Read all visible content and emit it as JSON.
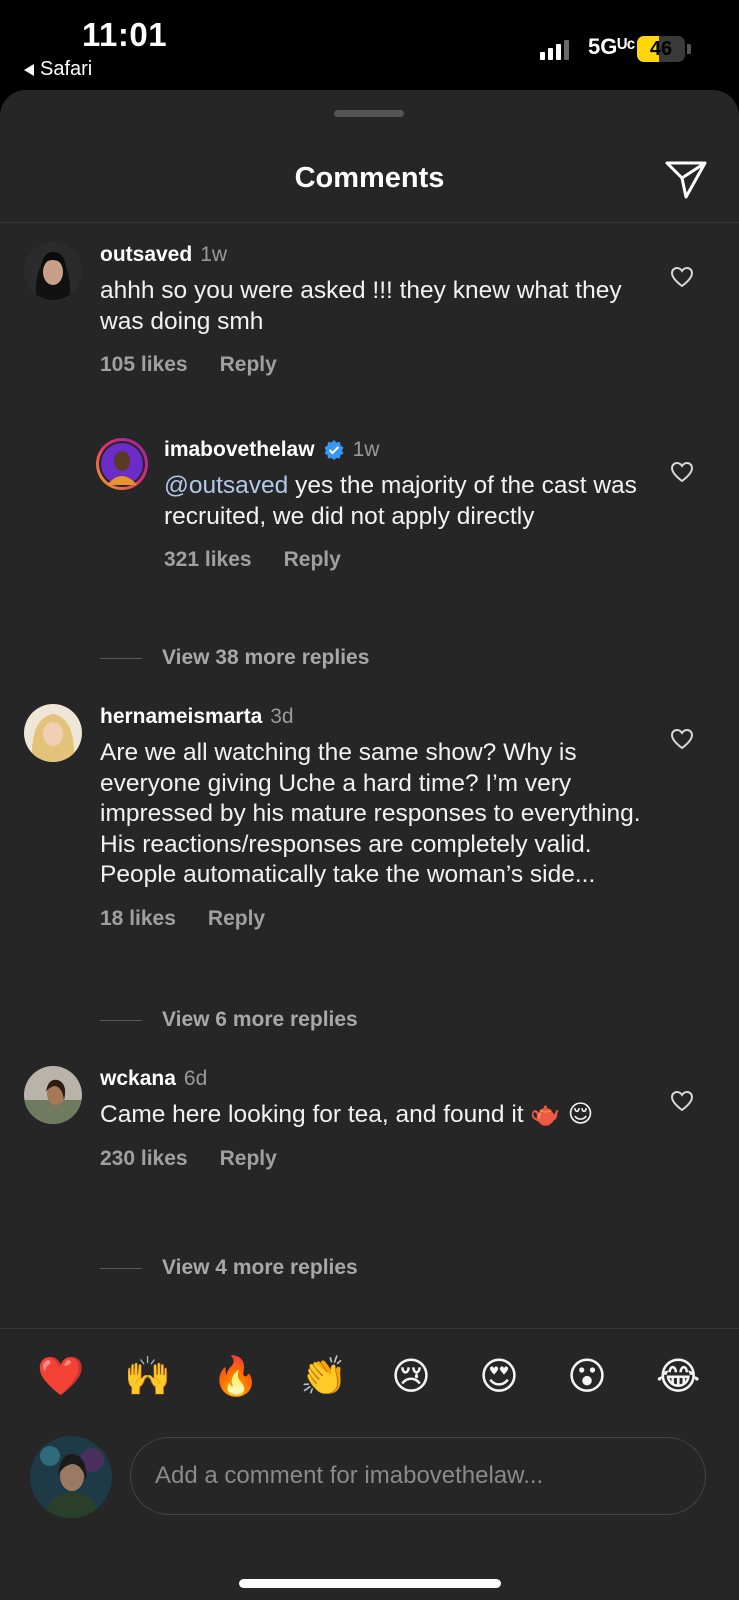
{
  "status_bar": {
    "time": "11:01",
    "back_app": "Safari",
    "network": "5Gᵁᶜ",
    "battery_percent": 46
  },
  "sheet": {
    "title": "Comments"
  },
  "comments": [
    {
      "username": "outsaved",
      "timestamp": "1w",
      "text": "ahhh so you were asked !!! they knew what they was doing smh",
      "likes": "105 likes",
      "reply": "Reply"
    },
    {
      "username": "imabovethelaw",
      "verified": true,
      "timestamp": "1w",
      "mention": "@outsaved",
      "text": " yes the majority of the cast was recruited, we did not apply directly",
      "likes": "321 likes",
      "reply": "Reply"
    },
    {
      "username": "hernameismarta",
      "timestamp": "3d",
      "text": "Are we all watching the same show? Why is everyone giving Uche a hard time? I’m very impressed by his mature responses to everything. His reactions/responses are completely valid. People automatically take the woman’s side...",
      "likes": "18 likes",
      "reply": "Reply"
    },
    {
      "username": "wckana",
      "timestamp": "6d",
      "text": "Came here looking for tea, and found it 🫖 😌",
      "likes": "230 likes",
      "reply": "Reply"
    }
  ],
  "view_more": [
    "View 38 more replies",
    "View 6 more replies",
    "View 4 more replies"
  ],
  "emojis": [
    "❤️",
    "🙌",
    "🔥",
    "👏",
    "😢",
    "😍",
    "😮",
    "😂"
  ],
  "composer": {
    "placeholder": "Add a comment for imabovethelaw..."
  },
  "colors": {
    "sheet_bg": "#262626",
    "verified_badge": "#3897f0",
    "mention": "#b3c7e8",
    "battery": "#ffd60a"
  },
  "icons": [
    "share-send-icon",
    "heart-icon",
    "verified-badge-icon",
    "signal-icon",
    "battery-icon"
  ]
}
